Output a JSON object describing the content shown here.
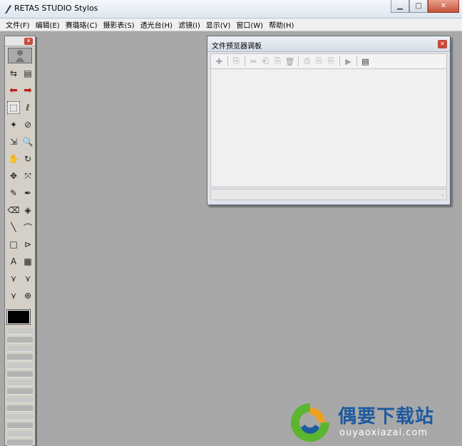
{
  "app": {
    "title": "RETAS STUDIO Stylos"
  },
  "window_controls": {
    "minimize": "▁",
    "maximize": "□",
    "close": "✕"
  },
  "menu": [
    "文件(F)",
    "编辑(E)",
    "赛璐珞(C)",
    "摄影表(S)",
    "透光台(H)",
    "滤镜(I)",
    "显示(V)",
    "窗口(W)",
    "帮助(H)"
  ],
  "toolbox": {
    "close_glyph": "✕",
    "tools": [
      [
        "⇆",
        "▤"
      ],
      [
        "⬅",
        "➡"
      ],
      [
        "⬚",
        "ℓ"
      ],
      [
        "✦",
        "⊘"
      ],
      [
        "⇲",
        "🔍"
      ],
      [
        "✋",
        "↻"
      ],
      [
        "✥",
        "⤧"
      ],
      [
        "✎",
        "✒"
      ],
      [
        "⌫",
        "◈"
      ],
      [
        "╲",
        "⌒"
      ],
      [
        "□",
        "⊳"
      ],
      [
        "A",
        "▦"
      ],
      [
        "⋎",
        "⋎"
      ],
      [
        "⋎",
        "⊕"
      ]
    ],
    "main_color": "#000000",
    "strip_count": 14
  },
  "palette": {
    "title": "文件预览器调板",
    "close_glyph": "✕",
    "toolbar": [
      "✚",
      "⎘",
      "✂",
      "⎗",
      "⎘",
      "🗑",
      "⎙",
      "⎘",
      "⎘",
      "▶",
      "▤"
    ],
    "grip": "⁘"
  },
  "watermark": {
    "name": "偶要下载站",
    "url": "ouyaoxiazai.com",
    "colors": {
      "blue": "#1d5aa0",
      "green": "#5cb531",
      "orange": "#f0a020"
    }
  }
}
